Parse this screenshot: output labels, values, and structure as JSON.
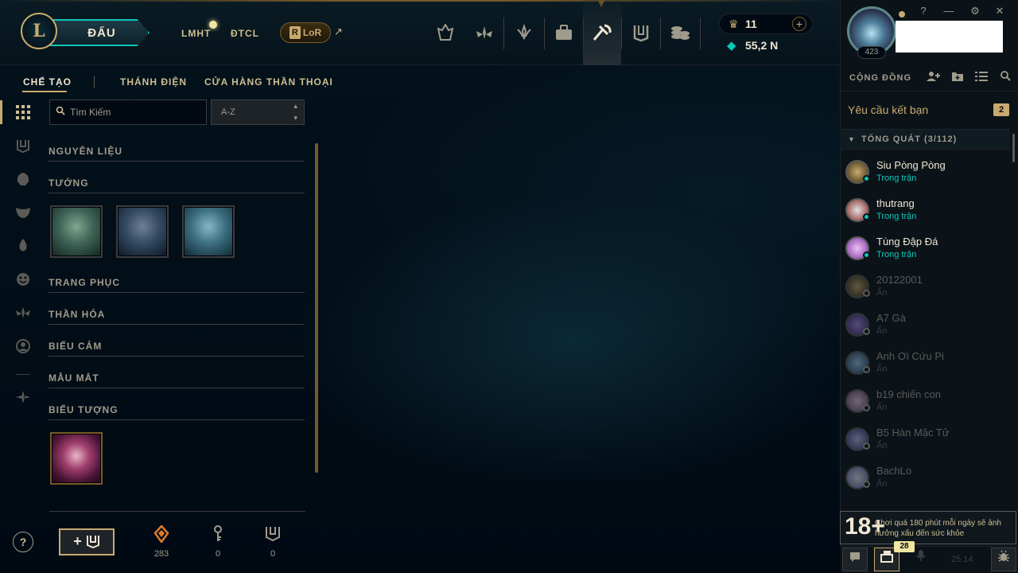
{
  "top": {
    "play_label": "ĐẤU",
    "nav_links": [
      "LMHT",
      "ĐTCL"
    ],
    "lor_label": "LoR",
    "lor_badge": "R",
    "rp_value": "11",
    "be_value": "55,2 N",
    "add_rp": "+",
    "external_arrow": "↗"
  },
  "subnav": {
    "items": [
      "CHẾ TẠO",
      "THÁNH ĐIỆN",
      "CỬA HÀNG THẦN THOẠI"
    ],
    "active_index": 0
  },
  "search": {
    "placeholder": "Tìm Kiếm",
    "sort_value": "A-Z",
    "sort_arrows": "⌃⌄"
  },
  "categories": [
    {
      "title": "NGUYÊN LIỆU"
    },
    {
      "title": "TƯỚNG"
    },
    {
      "title": "TRANG PHỤC"
    },
    {
      "title": "THẦN HỎA"
    },
    {
      "title": "BIỂU CẢM"
    },
    {
      "title": "MẪU MẮT"
    },
    {
      "title": "BIỂU TƯỢNG"
    }
  ],
  "resources": [
    {
      "icon": "orange-essence-icon",
      "value": "283"
    },
    {
      "icon": "key-icon",
      "value": "0"
    },
    {
      "icon": "chest-icon",
      "value": "0"
    }
  ],
  "craft_label": "+",
  "help_label": "?",
  "profile": {
    "level": "423"
  },
  "window": {
    "help": "?",
    "minimize": "—",
    "settings": "⚙",
    "close": "✕"
  },
  "social": {
    "header": "CỘNG ĐỒNG",
    "friend_requests": "Yêu cầu kết bạn",
    "friend_request_count": "2",
    "group_label": "TỔNG QUÁT (3/112)",
    "friends": [
      {
        "name": "Siu Pòng Pòng",
        "status": "Trong trận",
        "online": true
      },
      {
        "name": "thutrang",
        "status": "Trong trận",
        "online": true
      },
      {
        "name": "Tùng Đập Đá",
        "status": "Trong trận",
        "online": true
      },
      {
        "name": "20122001",
        "status": "Ẩn",
        "online": false
      },
      {
        "name": "A7 Gà",
        "status": "Ẩn",
        "online": false
      },
      {
        "name": "Anh Ơi Cứu Pi",
        "status": "Ẩn",
        "online": false
      },
      {
        "name": "b19 chiến con",
        "status": "Ẩn",
        "online": false
      },
      {
        "name": "B5 Hàn Mặc Tử",
        "status": "Ẩn",
        "online": false
      },
      {
        "name": "BachLo",
        "status": "Ẩn",
        "online": false
      }
    ],
    "age_rating": "18+",
    "age_warning": "Chơi quá 180 phút mỗi ngày sẽ ảnh hưởng xấu đến sức khỏe",
    "chat_badge": "28",
    "version": "25.14"
  },
  "colors": {
    "gold": "#c8aa6e",
    "teal": "#0ac8b9",
    "bg": "#010a13"
  }
}
